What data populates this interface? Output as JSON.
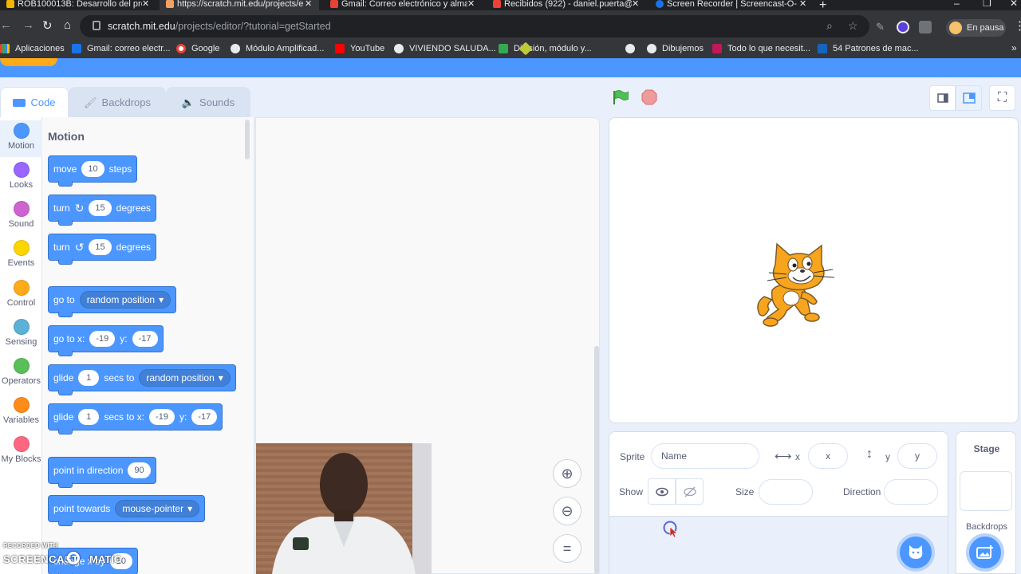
{
  "browser": {
    "tabs": [
      {
        "title": "ROB100013B: Desarrollo del proy",
        "active": false
      },
      {
        "title": "https://scratch.mit.edu/projects/e",
        "active": true
      },
      {
        "title": "Gmail: Correo electrónico y alma",
        "active": false
      },
      {
        "title": "Recibidos (922) - daniel.puerta@",
        "active": false
      },
      {
        "title": "Screen Recorder | Screencast-O-",
        "active": false
      }
    ],
    "url_host": "scratch.mit.edu",
    "url_path": "/projects/editor/?tutorial=getStarted",
    "profile_label": "En pausa",
    "bookmarks": [
      {
        "label": "Aplicaciones",
        "color": "#e8eaed"
      },
      {
        "label": "Gmail: correo electr...",
        "color": "#1a73e8"
      },
      {
        "label": "Google",
        "color": "#ea4335"
      },
      {
        "label": "Módulo Amplificad...",
        "color": "#e8eaed"
      },
      {
        "label": "YouTube",
        "color": "#ff0000"
      },
      {
        "label": "VIVIENDO SALUDA...",
        "color": "#e8eaed"
      },
      {
        "label": "División, módulo y...",
        "color": "#34a853"
      },
      {
        "label": "",
        "color": "#e8eaed"
      },
      {
        "label": "Dibujemos",
        "color": "#e8eaed"
      },
      {
        "label": "Todo lo que necesit...",
        "color": "#c2185b"
      },
      {
        "label": "54 Patrones de mac...",
        "color": "#1565c0"
      }
    ]
  },
  "scratch": {
    "editor_tabs": [
      {
        "label": "Code",
        "active": true
      },
      {
        "label": "Backdrops",
        "active": false
      },
      {
        "label": "Sounds",
        "active": false
      }
    ],
    "categories": [
      {
        "label": "Motion",
        "color": "#4c97ff"
      },
      {
        "label": "Looks",
        "color": "#9966ff"
      },
      {
        "label": "Sound",
        "color": "#cf63cf"
      },
      {
        "label": "Events",
        "color": "#ffd500"
      },
      {
        "label": "Control",
        "color": "#ffab19"
      },
      {
        "label": "Sensing",
        "color": "#5cb1d6"
      },
      {
        "label": "Operators",
        "color": "#59c059"
      },
      {
        "label": "Variables",
        "color": "#ff8c1a"
      },
      {
        "label": "My Blocks",
        "color": "#ff6680"
      }
    ],
    "palette_title": "Motion",
    "blocks": {
      "move": {
        "prefix": "move",
        "value": "10",
        "suffix": "steps"
      },
      "turn_right": {
        "prefix": "turn",
        "value": "15",
        "suffix": "degrees"
      },
      "turn_left": {
        "prefix": "turn",
        "value": "15",
        "suffix": "degrees"
      },
      "go_to": {
        "prefix": "go to",
        "option": "random position"
      },
      "go_to_xy": {
        "prefix": "go to x:",
        "x": "-19",
        "y_label": "y:",
        "y": "-17"
      },
      "glide_to": {
        "prefix": "glide",
        "secs": "1",
        "mid": "secs to",
        "option": "random position"
      },
      "glide_xy": {
        "prefix": "glide",
        "secs": "1",
        "mid": "secs to x:",
        "x": "-19",
        "y_label": "y:",
        "y": "-17"
      },
      "point_dir": {
        "prefix": "point in direction",
        "value": "90"
      },
      "point_towards": {
        "prefix": "point towards",
        "option": "mouse-pointer"
      },
      "change_x": {
        "prefix": "change x by",
        "value": "10"
      }
    },
    "sprite_info": {
      "sprite_label": "Sprite",
      "name_placeholder": "Name",
      "x_label": "x",
      "x_placeholder": "x",
      "y_label": "y",
      "y_placeholder": "y",
      "show_label": "Show",
      "size_label": "Size",
      "direction_label": "Direction"
    },
    "stage_pane": {
      "title": "Stage",
      "backdrops_label": "Backdrops"
    }
  },
  "watermark": {
    "line1": "RECORDED WITH",
    "line2": "SCREENCAST",
    "line3": "MATIC"
  }
}
